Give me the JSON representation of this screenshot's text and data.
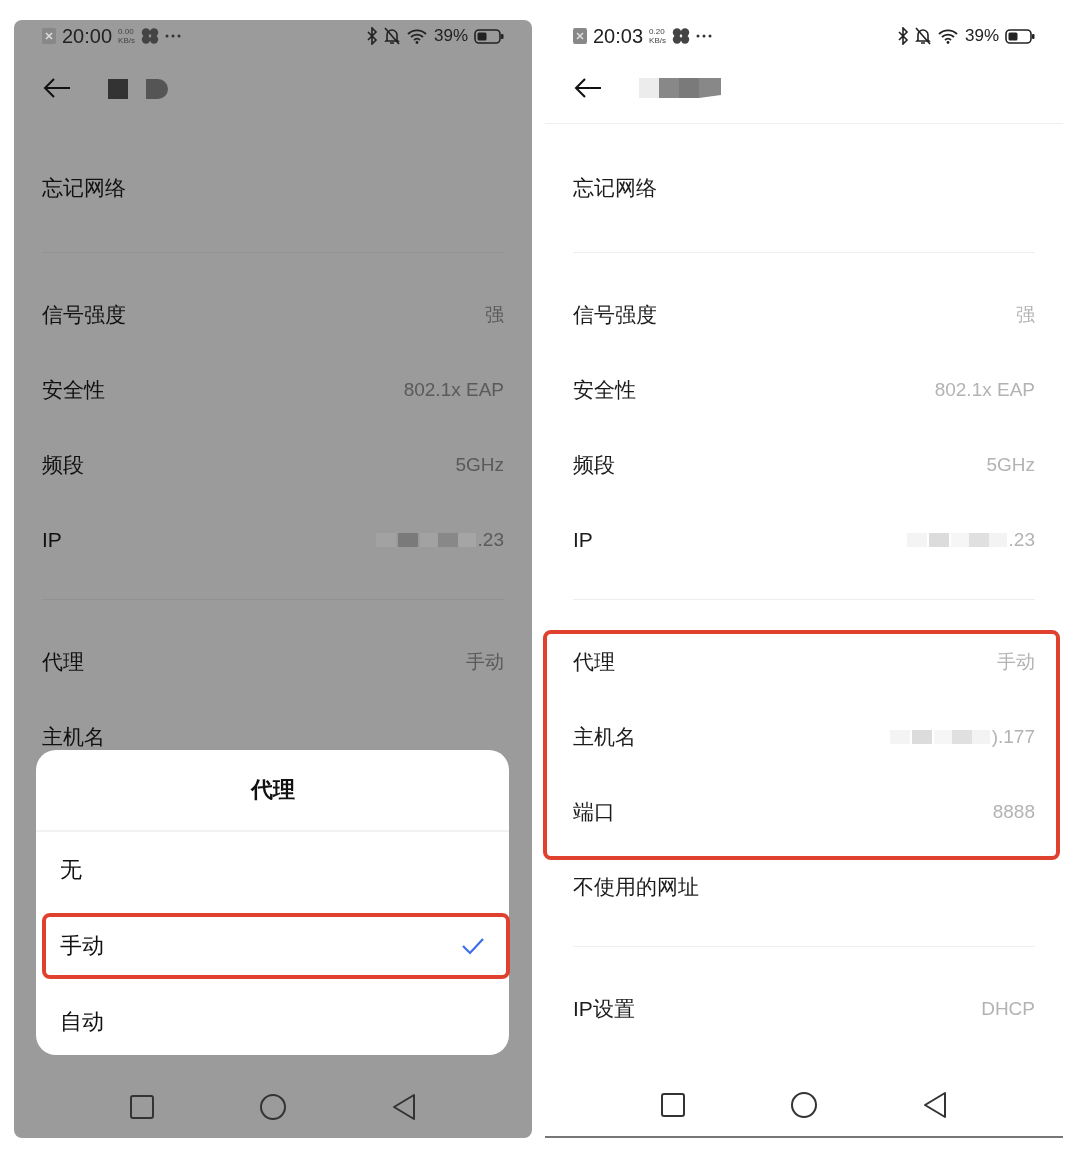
{
  "screens": [
    {
      "dimmed": true,
      "status_bar": {
        "time": "20:00",
        "speed": "0.00",
        "speed_unit": "KB/s",
        "battery": "39%"
      },
      "sections": [
        {
          "kind": "action",
          "rows": [
            {
              "label": "忘记网络",
              "highlighted": false
            }
          ]
        },
        {
          "kind": "info",
          "rows": [
            {
              "label": "信号强度",
              "value": "强",
              "highlighted": false
            },
            {
              "label": "安全性",
              "value": "802.1x EAP",
              "highlighted": false
            },
            {
              "label": "频段",
              "value": "5GHz",
              "highlighted": false
            },
            {
              "label": "IP",
              "value": ".23",
              "redacted": true,
              "highlighted": false
            }
          ]
        },
        {
          "kind": "info",
          "rows": [
            {
              "label": "代理",
              "value": "手动",
              "highlighted": false
            },
            {
              "label": "主机名",
              "highlighted": false
            }
          ]
        }
      ],
      "sheet": {
        "title": "代理",
        "options": [
          {
            "label": "无",
            "selected": false,
            "highlighted": false
          },
          {
            "label": "手动",
            "selected": true,
            "highlighted": true
          },
          {
            "label": "自动",
            "selected": false,
            "highlighted": false
          }
        ]
      }
    },
    {
      "dimmed": false,
      "status_bar": {
        "time": "20:03",
        "speed": "0.20",
        "speed_unit": "KB/s",
        "battery": "39%"
      },
      "sections": [
        {
          "kind": "action",
          "rows": [
            {
              "label": "忘记网络",
              "highlighted": false
            }
          ]
        },
        {
          "kind": "info",
          "rows": [
            {
              "label": "信号强度",
              "value": "强",
              "highlighted": false
            },
            {
              "label": "安全性",
              "value": "802.1x EAP",
              "highlighted": false
            },
            {
              "label": "频段",
              "value": "5GHz",
              "highlighted": false
            },
            {
              "label": "IP",
              "value": ".23",
              "redacted": true,
              "highlighted": false
            }
          ]
        },
        {
          "kind": "info",
          "rows": [
            {
              "label": "代理",
              "value": "手动",
              "highlighted": true
            },
            {
              "label": "主机名",
              "value": ").177",
              "redacted": true,
              "highlighted": true
            },
            {
              "label": "端口",
              "value": "8888",
              "highlighted": true
            },
            {
              "label": "不使用的网址",
              "highlighted": false
            }
          ]
        },
        {
          "kind": "info",
          "rows": [
            {
              "label": "IP设置",
              "value": "DHCP",
              "highlighted": false
            }
          ]
        }
      ]
    }
  ]
}
